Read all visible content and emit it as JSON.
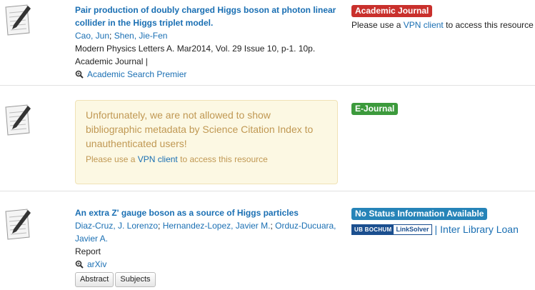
{
  "records": [
    {
      "title": "Pair production of doubly charged Higgs boson at photon linear collider in the Higgs triplet model.",
      "authors": [
        "Cao, Jun",
        "Shen, Jie-Fen"
      ],
      "source": "Modern Physics Letters A. Mar2014, Vol. 29 Issue 10, p-1. 10p.",
      "format": "Academic Journal |",
      "database": "Academic Search Premier",
      "badge": "Academic Journal",
      "vpn_prefix": "Please use a",
      "vpn_link": "VPN client",
      "vpn_suffix": "to access this resource"
    },
    {
      "warning_big": "Unfortunately, we are not allowed to show bibliographic metadata by Science Citation Index to unauthenticated users!",
      "vpn_prefix": "Please use a",
      "vpn_link": "VPN client",
      "vpn_suffix": "to access this resource",
      "badge": "E-Journal"
    },
    {
      "title": "An extra Z' gauge boson as a source of Higgs particles",
      "authors": [
        "Diaz-Cruz, J. Lorenzo",
        "Hernandez-Lopez, Javier M.",
        "Orduz-Ducuara, Javier A."
      ],
      "format": "Report",
      "database": "arXiv",
      "badge": "No Status Information Available",
      "linksolver_ub": "UB BOCHUM",
      "linksolver_label": "LinkSolver",
      "ill": "Inter Library Loan",
      "buttons": [
        "Abstract",
        "Subjects"
      ]
    }
  ],
  "colors": {
    "link": "#1a6fb3",
    "badge_red": "#c9302c",
    "badge_green": "#3c9a3c",
    "badge_blue": "#2684b8",
    "warn_bg": "#fcf8e3"
  }
}
